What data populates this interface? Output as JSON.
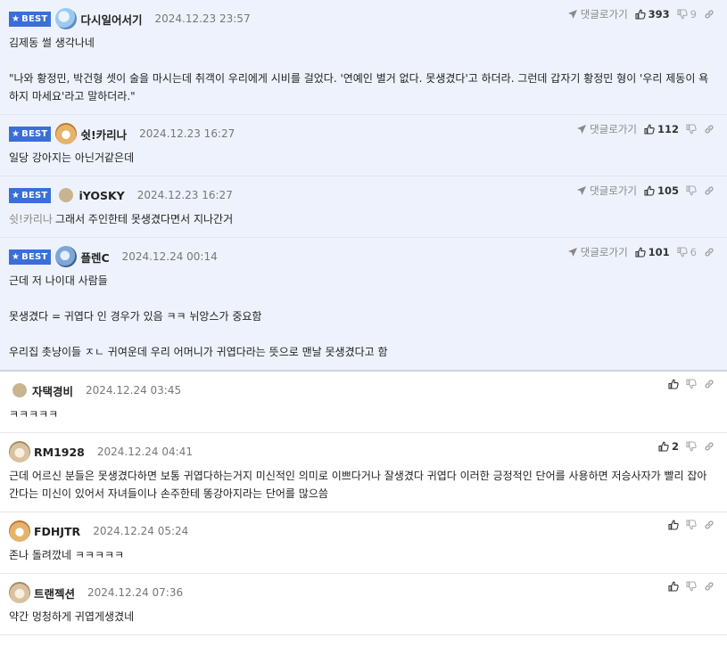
{
  "labels": {
    "best": "BEST",
    "reply_to": "댓글로가기"
  },
  "colors": {
    "best_bg": "#eef2fc",
    "badge": "#3a6fd8"
  },
  "comments": [
    {
      "best": true,
      "avatar": "blue-character-avatar",
      "nick": "다시일어서기",
      "date": "2024.12.23 23:57",
      "show_reply": true,
      "likes": "393",
      "dislikes": "9",
      "lines": [
        "김제동 썰 생각나네",
        "",
        "\"나와 황정민, 박건형 셋이 술을 마시는데 취객이 우리에게 시비를 걸었다. '연예인 별거 없다. 못생겼다'고 하더라. 그런데 갑자기 황정민 형이 '우리 제동이 욕하지 마세요'라고 말하더라.\""
      ]
    },
    {
      "best": true,
      "avatar": "fox-avatar",
      "nick": "쉿!카리나",
      "date": "2024.12.23 16:27",
      "show_reply": true,
      "likes": "112",
      "dislikes": "",
      "lines": [
        "일당 강아지는 아닌거같은데"
      ]
    },
    {
      "best": true,
      "avatar": "beige-dot-avatar",
      "nick": "iYOSKY",
      "date": "2024.12.23 16:27",
      "show_reply": true,
      "likes": "105",
      "dislikes": "",
      "ref": "쉿!카리나",
      "lines": [
        "그래서 주인한테 못생겼다면서 지나간거"
      ]
    },
    {
      "best": true,
      "avatar": "robot-avatar",
      "nick": "플렌C",
      "date": "2024.12.24 00:14",
      "show_reply": true,
      "likes": "101",
      "dislikes": "6",
      "lines": [
        "근데 저 나이대 사람들",
        "",
        "못생겼다 = 귀엽다 인 경우가 있음 ㅋㅋ 뉘앙스가 중요함",
        "",
        "우리집 촛냥이들 ㅈㄴ 귀여운데 우리 어머니가 귀엽다라는 뜻으로 맨날 못생겼다고 함"
      ]
    },
    {
      "best": false,
      "avatar": "beige-dot-avatar",
      "nick": "자택경비",
      "date": "2024.12.24 03:45",
      "show_reply": false,
      "likes": "",
      "dislikes": "",
      "lines": [
        "ㅋㅋㅋㅋㅋ"
      ]
    },
    {
      "best": false,
      "avatar": "puppy-avatar",
      "nick": "RM1928",
      "date": "2024.12.24 04:41",
      "show_reply": false,
      "likes": "2",
      "dislikes": "",
      "lines": [
        "근데 어르신 분들은 못생겼다하면 보통 귀엽다하는거지 미신적인 의미로 이쁘다거나 잘생겼다 귀엽다 이러한 긍정적인 단어를 사용하면 저승사자가 빨리 잡아간다는 미신이 있어서 자녀들이나 손주한테 똥강아지라는 단어를 많으씀"
      ]
    },
    {
      "best": false,
      "avatar": "fox-avatar",
      "nick": "FDHJTR",
      "date": "2024.12.24 05:24",
      "show_reply": false,
      "likes": "",
      "dislikes": "",
      "lines": [
        "존나 돌려깠네 ㅋㅋㅋㅋㅋ"
      ]
    },
    {
      "best": false,
      "avatar": "puppy-avatar",
      "nick": "트랜젝션",
      "date": "2024.12.24 07:36",
      "show_reply": false,
      "likes": "",
      "dislikes": "",
      "lines": [
        "약간 멍청하게 귀엽게생겼네"
      ]
    }
  ]
}
